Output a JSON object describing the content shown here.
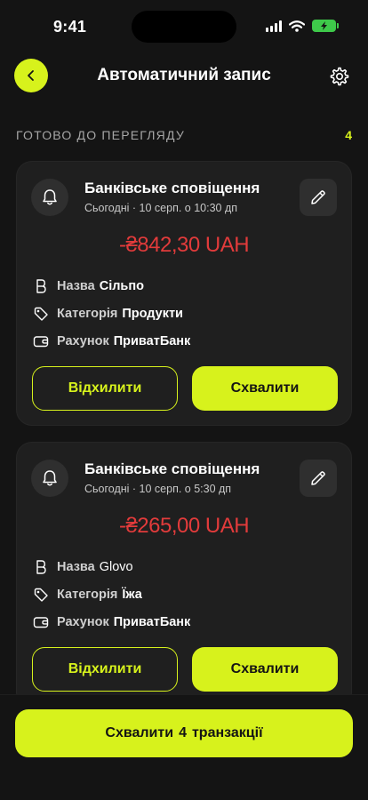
{
  "status_bar": {
    "time": "9:41"
  },
  "header": {
    "title": "Автоматичний запис"
  },
  "section": {
    "label": "ГОТОВО ДО ПЕРЕГЛЯДУ",
    "count": "4"
  },
  "colors": {
    "accent": "#d7f21c",
    "background": "#141414",
    "card": "#1f1f1f",
    "amount": "#e23b3b"
  },
  "cards": [
    {
      "source": "Банківське сповіщення",
      "date": "Сьогодні · 10 серп. о 10:30 дп",
      "amount": "-₴842,30 UAH",
      "name_label": "Назва",
      "name_value": "Сільпо",
      "category_label": "Категорія",
      "category_value": "Продукти",
      "account_label": "Рахунок",
      "account_value": "ПриватБанк",
      "decline_label": "Відхилити",
      "approve_label": "Схвалити"
    },
    {
      "source": "Банківське сповіщення",
      "date": "Сьогодні · 10 серп. о 5:30 дп",
      "amount": "-₴265,00 UAH",
      "name_label": "Назва",
      "name_value": "Glovo",
      "category_label": "Категорія",
      "category_value": "Їжа",
      "account_label": "Рахунок",
      "account_value": "ПриватБанк",
      "decline_label": "Відхилити",
      "approve_label": "Схвалити"
    }
  ],
  "footer": {
    "approve_all_prefix": "Схвалити",
    "approve_all_count": "4",
    "approve_all_suffix": "транзакції"
  },
  "icons": {
    "back": "chevron-left-icon",
    "settings": "gear-icon",
    "source": "bell-icon",
    "edit": "pencil-icon",
    "name": "letter-b-icon",
    "category": "tag-icon",
    "account": "wallet-icon"
  }
}
